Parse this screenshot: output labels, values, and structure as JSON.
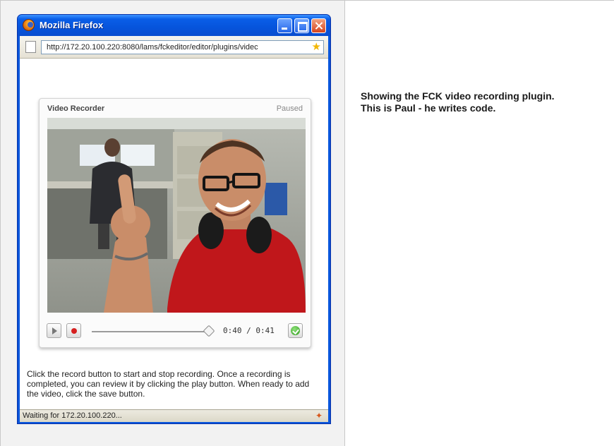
{
  "browser": {
    "title": "Mozilla Firefox",
    "url": "http://172.20.100.220:8080/lams/fckeditor/editor/plugins/videc",
    "status": "Waiting for 172.20.100.220..."
  },
  "recorder": {
    "title": "Video Recorder",
    "status": "Paused",
    "time": "0:40 / 0:41",
    "progress_fraction": 0.97
  },
  "instructions": "Click the record button to start and stop recording. Once a recording is completed, you can review it by clicking the play button. When ready to add the video, click the save button.",
  "caption": {
    "line1": "Showing the FCK video recording plugin.",
    "line2": "This is Paul - he writes code."
  },
  "colors": {
    "titlebar": "#0654dc",
    "record": "#d62020",
    "save": "#2e9a1c"
  },
  "icons": [
    "firefox-logo-icon",
    "minimize-icon",
    "maximize-icon",
    "close-icon",
    "page-icon",
    "bookmark-star-icon",
    "play-icon",
    "record-icon",
    "save-check-icon",
    "loading-icon"
  ]
}
